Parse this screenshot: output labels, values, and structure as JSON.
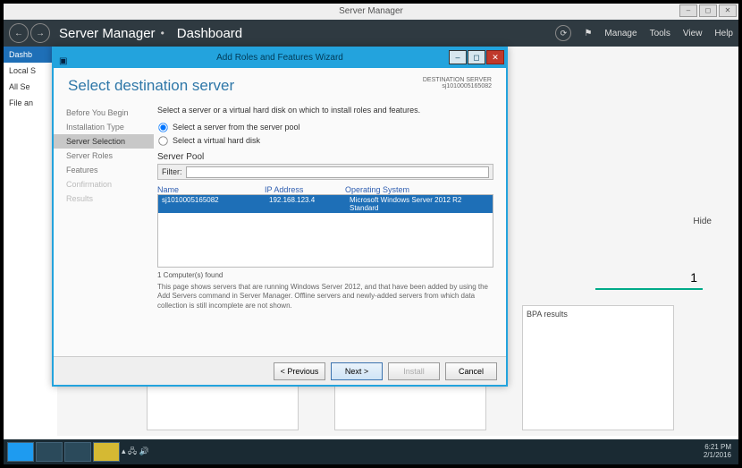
{
  "app": {
    "title": "Server Manager"
  },
  "window_controls": {
    "min": "–",
    "max": "◻",
    "close": "✕"
  },
  "header": {
    "back": "←",
    "fwd": "→",
    "app_name": "Server Manager",
    "separator": "•",
    "page": "Dashboard",
    "refresh": "⟳",
    "flag": "⚑",
    "menu": {
      "manage": "Manage",
      "tools": "Tools",
      "view": "View",
      "help": "Help"
    }
  },
  "leftnav": {
    "dashboard": "Dashb",
    "local": "Local S",
    "all": "All Se",
    "file": "File an"
  },
  "background": {
    "hide": "Hide",
    "number": "1",
    "bpa": "BPA results"
  },
  "wizard": {
    "title": "Add Roles and Features Wizard",
    "controls": {
      "min": "–",
      "max": "◻",
      "close": "✕"
    },
    "heading": "Select destination server",
    "dest_label": "DESTINATION SERVER",
    "dest_server": "sj1010005165082",
    "nav": {
      "before": "Before You Begin",
      "type": "Installation Type",
      "selection": "Server Selection",
      "roles": "Server Roles",
      "features": "Features",
      "confirm": "Confirmation",
      "results": "Results"
    },
    "instruction": "Select a server or a virtual hard disk on which to install roles and features.",
    "radio_pool": "Select a server from the server pool",
    "radio_vhd": "Select a virtual hard disk",
    "pool_label": "Server Pool",
    "filter_label": "Filter:",
    "filter_placeholder": "",
    "cols": {
      "name": "Name",
      "ip": "IP Address",
      "os": "Operating System"
    },
    "servers": [
      {
        "name": "sj1010005165082",
        "ip": "192.168.123.4",
        "os": "Microsoft Windows Server 2012 R2 Standard"
      }
    ],
    "found": "1 Computer(s) found",
    "description": "This page shows servers that are running Windows Server 2012, and that have been added by using the Add Servers command in Server Manager. Offline servers and newly-added servers from which data collection is still incomplete are not shown.",
    "buttons": {
      "prev": "< Previous",
      "next": "Next >",
      "install": "Install",
      "cancel": "Cancel"
    }
  },
  "taskbar": {
    "time": "6:21 PM",
    "date": "2/1/2016",
    "tray": "▴ 🖧 🔊"
  }
}
